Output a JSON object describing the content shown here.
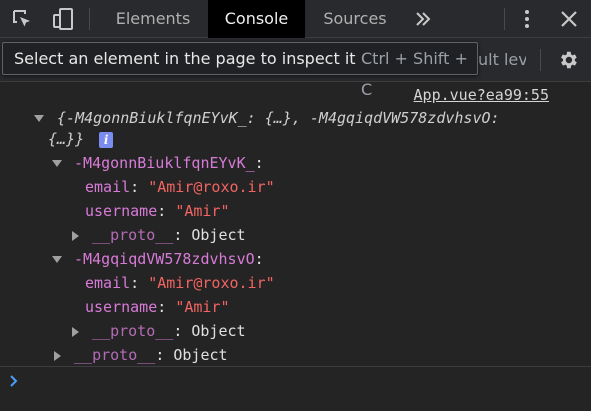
{
  "tabs": [
    {
      "label": "Elements",
      "active": false
    },
    {
      "label": "Console",
      "active": true
    },
    {
      "label": "Sources",
      "active": false
    }
  ],
  "icons": {
    "inspect": "inspect-element-icon",
    "device": "device-toolbar-icon",
    "more_tabs": "more-tabs-chevron-icon",
    "menu": "kebab-menu-icon",
    "close": "close-icon",
    "settings": "gear-icon",
    "info": "info-icon",
    "prompt": "prompt-chevron-icon"
  },
  "toolbar": {
    "tooltip_text": "Select an element in the page to inspect it",
    "tooltip_shortcut": "Ctrl + Shift + C",
    "level_label": "ult lev"
  },
  "console": {
    "source_link": "App.vue?ea99:55",
    "summary_line1": "{-M4gonnBiuklfqnEYvK_: {…}, -M4gqiqdVW578zdvhsvO:",
    "summary_line2": "{…}}",
    "info_glyph": "i",
    "objects": [
      {
        "key": "-M4gonnBiuklfqnEYvK_",
        "email_key": "email",
        "email": "\"Amir@roxo.ir\"",
        "username_key": "username",
        "username": "\"Amir\"",
        "proto_key": "__proto__",
        "proto_value": "Object"
      },
      {
        "key": "-M4gqiqdVW578zdvhsvO",
        "email_key": "email",
        "email": "\"Amir@roxo.ir\"",
        "username_key": "username",
        "username": "\"Amir\"",
        "proto_key": "__proto__",
        "proto_value": "Object"
      }
    ],
    "root_proto_key": "__proto__",
    "root_proto_value": "Object"
  },
  "colors": {
    "key": "#d77bd8",
    "string": "#f16461",
    "background": "#242424",
    "active_tab": "#000000",
    "prompt_accent": "#4d9dff"
  }
}
